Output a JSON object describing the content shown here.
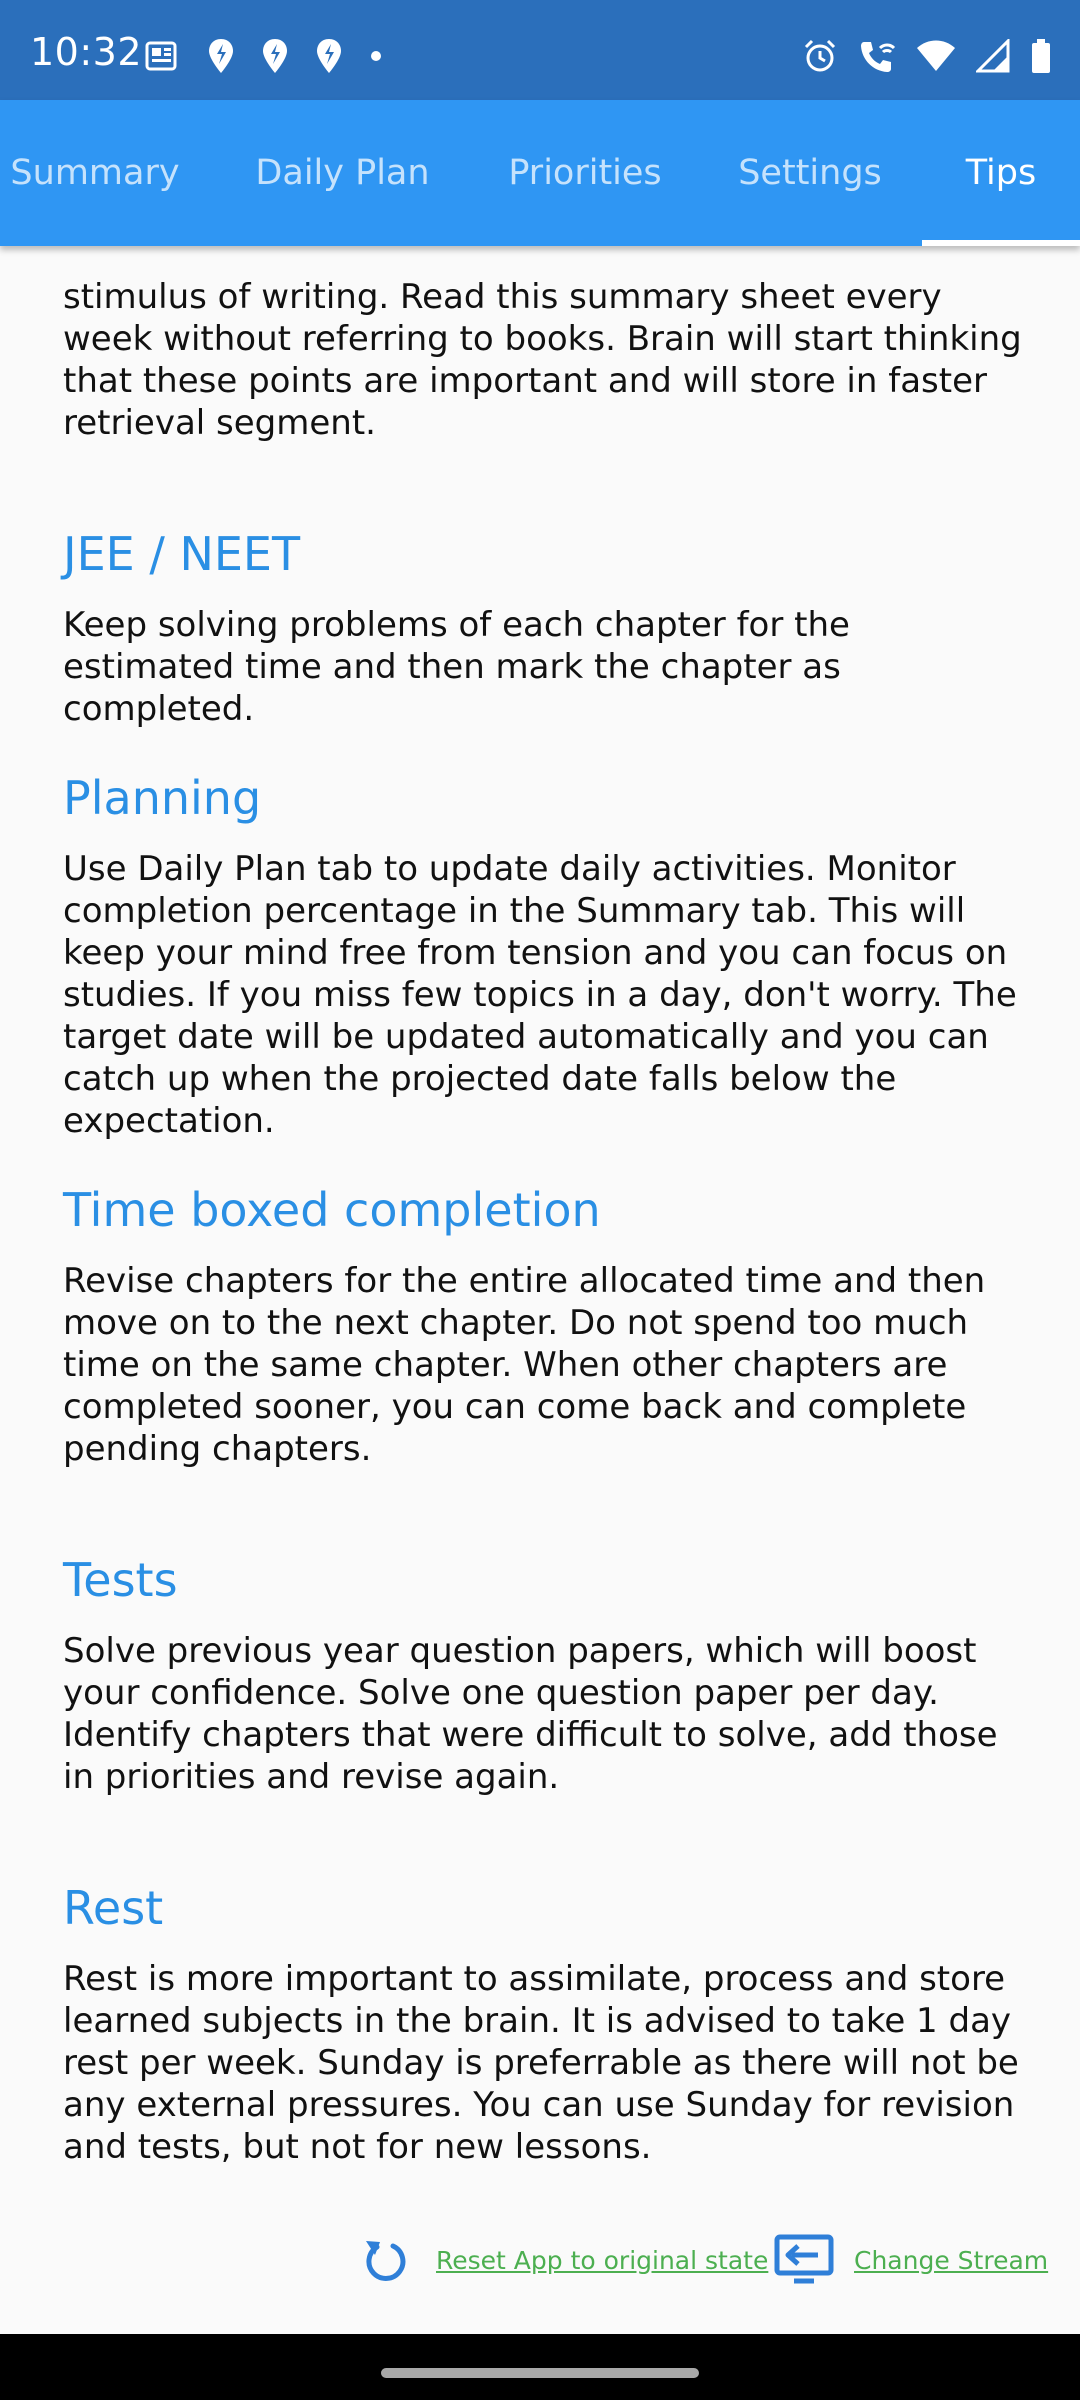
{
  "status_bar": {
    "time": "10:32",
    "left_icons": [
      "news-icon",
      "app-notification-icon",
      "app-notification-icon",
      "app-notification-icon",
      "more-dot-icon"
    ],
    "right_icons": [
      "alarm-icon",
      "wifi-calling-icon",
      "wifi-icon",
      "signal-icon",
      "battery-icon"
    ]
  },
  "tabs": [
    {
      "label": "Summary",
      "active": false
    },
    {
      "label": "Daily Plan",
      "active": false
    },
    {
      "label": "Priorities",
      "active": false
    },
    {
      "label": "Settings",
      "active": false
    },
    {
      "label": "Tips",
      "active": true
    }
  ],
  "colors": {
    "status_bar": "#2b6fbb",
    "tab_bar": "#2f96f3",
    "heading": "#2a8fe4",
    "link": "#4caf50"
  },
  "tips": {
    "intro_tail": "stimulus of writing. Read this summary sheet every week without referring to books. Brain will start thinking that these points are important and will store in faster retrieval segment.",
    "sections": [
      {
        "title": "JEE / NEET",
        "body": "Keep solving problems of each chapter for the estimated time and then mark the chapter as completed."
      },
      {
        "title": "Planning",
        "body": "Use Daily Plan tab to update daily activities. Monitor completion percentage in the Summary tab. This will keep your mind free from tension and you can focus on studies. If you miss few topics in a day, don't worry. The target date will be updated automatically and you can catch up when the projected date falls below the expectation."
      },
      {
        "title": "Time boxed completion",
        "body": "Revise chapters for the entire allocated time and then move on to the next chapter. Do not spend too much time on the same chapter. When other chapters are completed sooner, you can come back and complete pending chapters."
      },
      {
        "title": "Tests",
        "body": "Solve previous year question papers, which will boost your confidence. Solve one question paper per day. Identify chapters that were difficult to solve, add those in priorities and revise again."
      },
      {
        "title": "Rest",
        "body": "Rest is more important to assimilate, process and store learned subjects in the brain. It is advised to take 1 day rest per week. Sunday is preferrable as there will not be any external pressures. You can use Sunday for revision and tests, but not for new lessons."
      }
    ]
  },
  "actions": {
    "reset_label": "Reset App to original state",
    "reset_icon": "refresh-icon",
    "change_stream_label": "Change Stream",
    "change_stream_icon": "change-stream-icon"
  }
}
